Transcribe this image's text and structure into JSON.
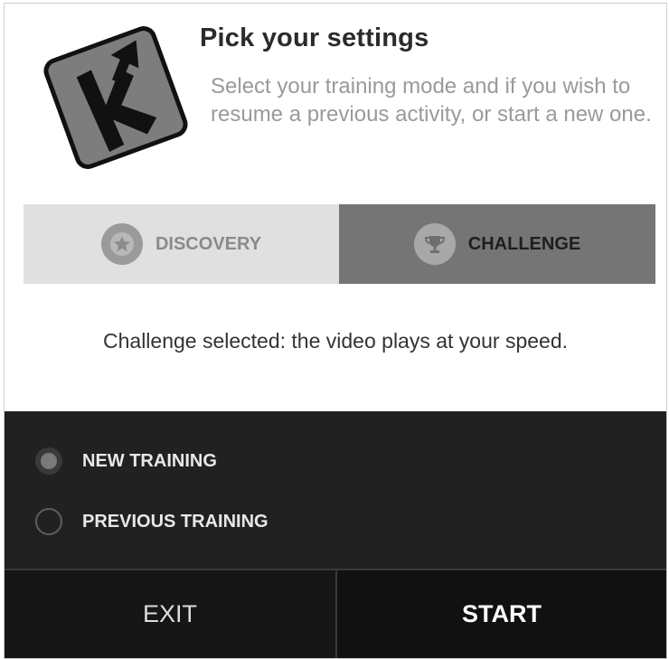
{
  "header": {
    "title": "Pick your settings",
    "subtitle": "Select your training mode and if you wish to resume a previous activity, or start a new one.",
    "logo_letter": "K"
  },
  "mode_toggle": {
    "selected": "challenge",
    "options": [
      {
        "id": "discovery",
        "label": "DISCOVERY",
        "icon": "star-icon",
        "selected": false
      },
      {
        "id": "challenge",
        "label": "CHALLENGE",
        "icon": "trophy-icon",
        "selected": true
      }
    ]
  },
  "status": {
    "text": "Challenge selected: the video plays at your speed."
  },
  "training": {
    "options": [
      {
        "label": "NEW TRAINING",
        "checked": true
      },
      {
        "label": "PREVIOUS TRAINING",
        "checked": false
      }
    ]
  },
  "footer": {
    "exit_label": "EXIT",
    "start_label": "START"
  },
  "colors": {
    "dark_panel": "#212121",
    "footer": "#111111",
    "selected_mode": "#757575",
    "unselected_mode": "#e0e0e0",
    "subtitle_text": "#9a9a9a"
  }
}
